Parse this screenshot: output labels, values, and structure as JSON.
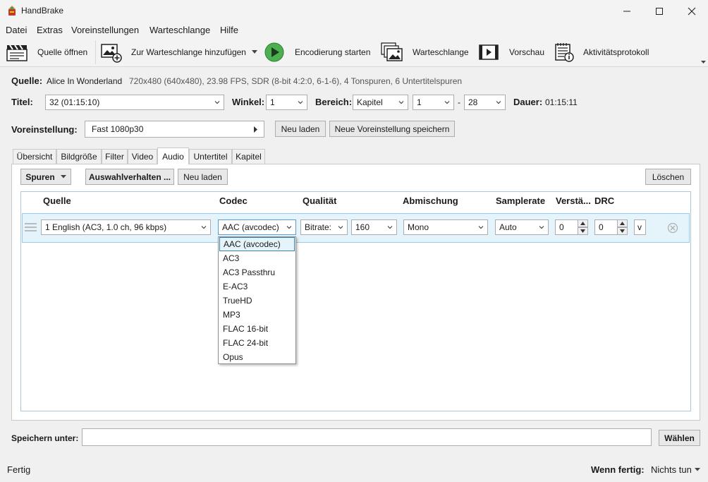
{
  "window": {
    "title": "HandBrake",
    "brand_color": "#2e7d32"
  },
  "menu": [
    "Datei",
    "Extras",
    "Voreinstellungen",
    "Warteschlange",
    "Hilfe"
  ],
  "toolbar": {
    "open_source": "Quelle öffnen",
    "add_queue": "Zur Warteschlange hinzufügen",
    "start": "Encodierung starten",
    "queue": "Warteschlange",
    "preview": "Vorschau",
    "activity": "Aktivitätsprotokoll"
  },
  "source": {
    "label": "Quelle:",
    "name": "Alice In Wonderland",
    "info": "720x480 (640x480), 23.98 FPS, SDR (8-bit 4:2:0, 6-1-6), 4 Tonspuren, 6 Untertitelspuren"
  },
  "title_row": {
    "title_label": "Titel:",
    "title_value": "32  (01:15:10)",
    "angle_label": "Winkel:",
    "angle_value": "1",
    "range_label": "Bereich:",
    "range_type": "Kapitel",
    "range_start": "1",
    "range_sep": "-",
    "range_end": "28",
    "duration_label": "Dauer:",
    "duration_value": "01:15:11"
  },
  "preset": {
    "label": "Voreinstellung:",
    "value": "Fast 1080p30",
    "reload": "Neu laden",
    "save_new": "Neue Voreinstellung speichern"
  },
  "tabs": [
    "Übersicht",
    "Bildgröße",
    "Filter",
    "Video",
    "Audio",
    "Untertitel",
    "Kapitel"
  ],
  "audio": {
    "tracks_btn": "Spuren",
    "selection_btn": "Auswahlverhalten ...",
    "reload_btn": "Neu laden",
    "delete_btn": "Löschen",
    "columns": [
      "Quelle",
      "Codec",
      "Qualität",
      "Abmischung",
      "Samplerate",
      "Verstä...",
      "DRC"
    ],
    "track": {
      "source": "1 English (AC3, 1.0 ch, 96 kbps)",
      "codec": "AAC (avcodec)",
      "quality_mode": "Bitrate:",
      "bitrate": "160",
      "mixdown": "Mono",
      "samplerate": "Auto",
      "gain": "0",
      "drc": "0",
      "more": "v"
    },
    "codec_options": [
      "AAC (avcodec)",
      "AC3",
      "AC3 Passthru",
      "E-AC3",
      "TrueHD",
      "MP3",
      "FLAC 16-bit",
      "FLAC 24-bit",
      "Opus"
    ]
  },
  "save": {
    "label": "Speichern unter:",
    "value": "",
    "browse": "Wählen"
  },
  "status": {
    "text": "Fertig",
    "when_done_label": "Wenn fertig:",
    "when_done_value": "Nichts tun"
  }
}
